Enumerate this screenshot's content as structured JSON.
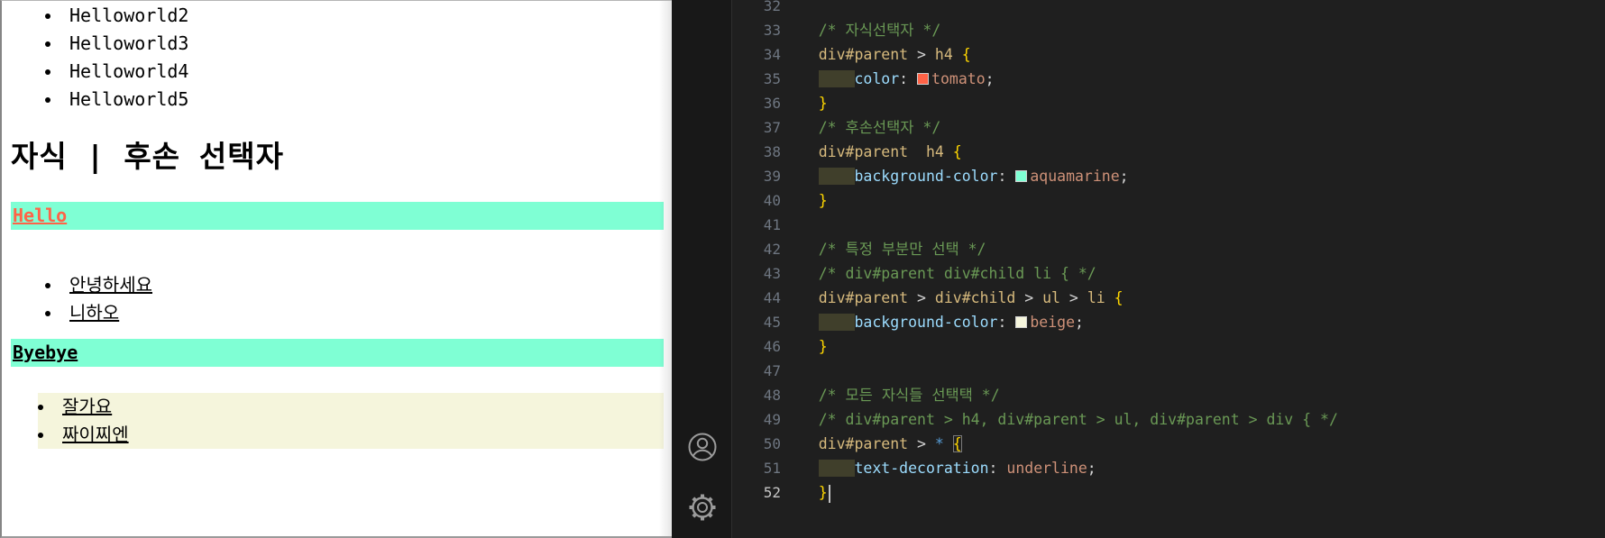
{
  "page": {
    "top_list": [
      "Helloworld2",
      "Helloworld3",
      "Helloworld4",
      "Helloworld5"
    ],
    "heading": "자식 | 후손 선택자",
    "hello_heading": "Hello",
    "greet_list": [
      "안녕하세요",
      "니하오"
    ],
    "byebye_heading": "Byebye",
    "farewell_list": [
      "잘가요",
      "짜이찌엔"
    ],
    "colors": {
      "highlight_bar": "#7fffd4",
      "hello_text": "#ff6347",
      "farewell_bg": "#f5f5dc"
    }
  },
  "activity_bar": {
    "icons": [
      "account-icon",
      "settings-gear-icon"
    ]
  },
  "editor": {
    "active_line": "52",
    "colors": {
      "background": "#1f1f1f",
      "comment": "#6a9955",
      "selector": "#d7ba7d",
      "property": "#9cdcfe",
      "value": "#ce9178",
      "brace": "#ffd700",
      "indent_selection": "#403f2b"
    },
    "lines": [
      {
        "num": "32",
        "tokens": []
      },
      {
        "num": "33",
        "tokens": [
          {
            "t": "    ",
            "c": "ws"
          },
          {
            "t": "/* 자식선택자 */",
            "c": "cm"
          }
        ]
      },
      {
        "num": "34",
        "tokens": [
          {
            "t": "    ",
            "c": "ws"
          },
          {
            "t": "div#parent",
            "c": "sel"
          },
          {
            "t": " > ",
            "c": "pun"
          },
          {
            "t": "h4",
            "c": "sel"
          },
          {
            "t": " ",
            "c": "ws"
          },
          {
            "t": "{",
            "c": "br"
          }
        ]
      },
      {
        "num": "35",
        "tokens": [
          {
            "t": "    ",
            "c": "ws"
          },
          {
            "t": "    ",
            "c": "selbox"
          },
          {
            "t": "color",
            "c": "prop"
          },
          {
            "t": ": ",
            "c": "pun"
          },
          {
            "c": "swatch",
            "color": "#ff6347"
          },
          {
            "t": "tomato",
            "c": "val"
          },
          {
            "t": ";",
            "c": "pun"
          }
        ]
      },
      {
        "num": "36",
        "tokens": [
          {
            "t": "    ",
            "c": "ws"
          },
          {
            "t": "}",
            "c": "br"
          }
        ]
      },
      {
        "num": "37",
        "tokens": [
          {
            "t": "    ",
            "c": "ws"
          },
          {
            "t": "/* 후손선택자 */",
            "c": "cm"
          }
        ]
      },
      {
        "num": "38",
        "tokens": [
          {
            "t": "    ",
            "c": "ws"
          },
          {
            "t": "div#parent",
            "c": "sel"
          },
          {
            "t": "  ",
            "c": "ws"
          },
          {
            "t": "h4",
            "c": "sel"
          },
          {
            "t": " ",
            "c": "ws"
          },
          {
            "t": "{",
            "c": "br"
          }
        ]
      },
      {
        "num": "39",
        "tokens": [
          {
            "t": "    ",
            "c": "ws"
          },
          {
            "t": "    ",
            "c": "selbox"
          },
          {
            "t": "background-color",
            "c": "prop"
          },
          {
            "t": ": ",
            "c": "pun"
          },
          {
            "c": "swatch",
            "color": "#7fffd4"
          },
          {
            "t": "aquamarine",
            "c": "val"
          },
          {
            "t": ";",
            "c": "pun"
          }
        ]
      },
      {
        "num": "40",
        "tokens": [
          {
            "t": "    ",
            "c": "ws"
          },
          {
            "t": "}",
            "c": "br"
          }
        ]
      },
      {
        "num": "41",
        "tokens": []
      },
      {
        "num": "42",
        "tokens": [
          {
            "t": "    ",
            "c": "ws"
          },
          {
            "t": "/* 특정 부분만 선택 */",
            "c": "cm"
          }
        ]
      },
      {
        "num": "43",
        "tokens": [
          {
            "t": "    ",
            "c": "ws"
          },
          {
            "t": "/* div#parent div#child li { */",
            "c": "cm"
          }
        ]
      },
      {
        "num": "44",
        "tokens": [
          {
            "t": "    ",
            "c": "ws"
          },
          {
            "t": "div#parent",
            "c": "sel"
          },
          {
            "t": " > ",
            "c": "pun"
          },
          {
            "t": "div#child",
            "c": "sel"
          },
          {
            "t": " > ",
            "c": "pun"
          },
          {
            "t": "ul",
            "c": "sel"
          },
          {
            "t": " > ",
            "c": "pun"
          },
          {
            "t": "li",
            "c": "sel"
          },
          {
            "t": " ",
            "c": "ws"
          },
          {
            "t": "{",
            "c": "br"
          }
        ]
      },
      {
        "num": "45",
        "tokens": [
          {
            "t": "    ",
            "c": "ws"
          },
          {
            "t": "    ",
            "c": "selbox"
          },
          {
            "t": "background-color",
            "c": "prop"
          },
          {
            "t": ": ",
            "c": "pun"
          },
          {
            "c": "swatch",
            "color": "#f5f5dc"
          },
          {
            "t": "beige",
            "c": "val"
          },
          {
            "t": ";",
            "c": "pun"
          }
        ]
      },
      {
        "num": "46",
        "tokens": [
          {
            "t": "    ",
            "c": "ws"
          },
          {
            "t": "}",
            "c": "br"
          }
        ]
      },
      {
        "num": "47",
        "tokens": []
      },
      {
        "num": "48",
        "tokens": [
          {
            "t": "    ",
            "c": "ws"
          },
          {
            "t": "/* 모든 자식들 선택택 */",
            "c": "cm"
          }
        ]
      },
      {
        "num": "49",
        "tokens": [
          {
            "t": "    ",
            "c": "ws"
          },
          {
            "t": "/* div#parent > h4, div#parent > ul, div#parent > div { */",
            "c": "cm"
          }
        ]
      },
      {
        "num": "50",
        "tokens": [
          {
            "t": "    ",
            "c": "ws"
          },
          {
            "t": "div#parent",
            "c": "sel"
          },
          {
            "t": " > ",
            "c": "pun"
          },
          {
            "t": "*",
            "c": "star"
          },
          {
            "t": " ",
            "c": "ws"
          },
          {
            "t": "{",
            "c": "br match"
          }
        ]
      },
      {
        "num": "51",
        "tokens": [
          {
            "t": "    ",
            "c": "ws"
          },
          {
            "t": "    ",
            "c": "selbox"
          },
          {
            "t": "text-decoration",
            "c": "prop"
          },
          {
            "t": ": ",
            "c": "pun"
          },
          {
            "t": "underline",
            "c": "val"
          },
          {
            "t": ";",
            "c": "pun"
          }
        ]
      },
      {
        "num": "52",
        "tokens": [
          {
            "t": "    ",
            "c": "ws"
          },
          {
            "t": "}",
            "c": "br"
          },
          {
            "c": "cursor"
          }
        ]
      }
    ]
  }
}
